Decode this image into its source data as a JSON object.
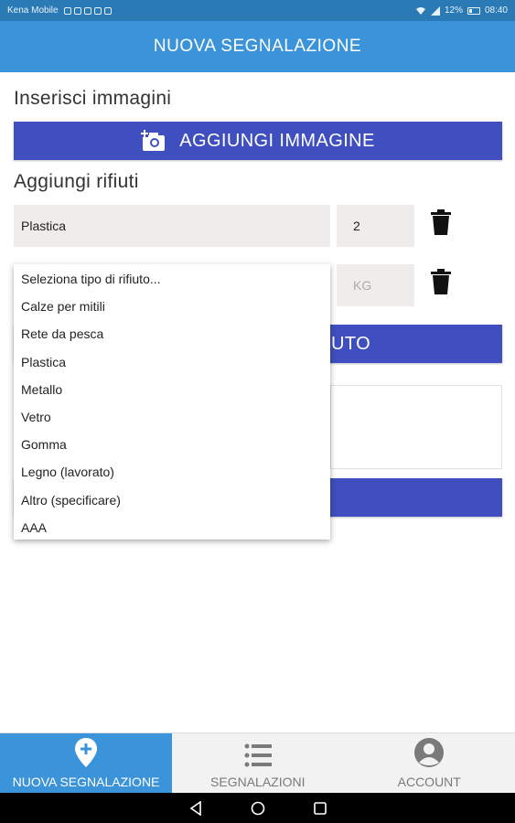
{
  "status_bar": {
    "carrier": "Kena Mobile",
    "battery": "12%",
    "time": "08:40"
  },
  "header": {
    "title": "NUOVA SEGNALAZIONE"
  },
  "images_section": {
    "label": "Inserisci immagini",
    "add_button": "AGGIUNGI IMMAGINE"
  },
  "waste_section": {
    "label": "Aggiungi rifiuti",
    "rows": [
      {
        "type": "Plastica",
        "quantity": "2"
      },
      {
        "type": "",
        "quantity_placeholder": "KG"
      }
    ],
    "hidden_button_suffix": "UTO"
  },
  "dropdown": {
    "options": [
      "Seleziona tipo di rifiuto...",
      "Calze per mitili",
      "Rete da pesca",
      "Plastica",
      "Metallo",
      "Vetro",
      "Gomma",
      "Legno (lavorato)",
      "Altro (specificare)",
      "AAA"
    ]
  },
  "bottom_nav": {
    "items": [
      {
        "label": "NUOVA SEGNALAZIONE",
        "icon": "map-pin-plus-icon",
        "active": true
      },
      {
        "label": "SEGNALAZIONI",
        "icon": "list-icon",
        "active": false
      },
      {
        "label": "ACCOUNT",
        "icon": "account-circle-icon",
        "active": false
      }
    ]
  },
  "colors": {
    "header": "#3b93d9",
    "status_bar": "#2a7ab6",
    "button": "#3f4fbf",
    "field_bg": "#efedeb"
  }
}
